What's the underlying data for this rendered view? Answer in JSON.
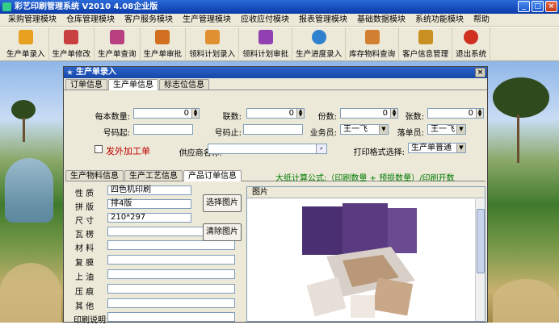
{
  "app": {
    "title": "彩艺印刷管理系统  V2010  4.08企业版"
  },
  "window_controls": {
    "minimize": "_",
    "maximize": "□",
    "close": "×"
  },
  "menu": [
    "采购管理模块",
    "仓库管理模块",
    "客户服务模块",
    "生产管理模块",
    "应收应付模块",
    "报表管理模块",
    "基础数据模块",
    "系统功能模块",
    "帮助"
  ],
  "toolbar": [
    {
      "label": "生产单录入",
      "icon": "doc-entry-icon",
      "color": "#e8a020"
    },
    {
      "label": "生产单修改",
      "icon": "doc-edit-icon",
      "color": "#c84040"
    },
    {
      "label": "生产单查询",
      "icon": "doc-search-icon",
      "color": "#b84080"
    },
    {
      "label": "生产单审批",
      "icon": "doc-approve-icon",
      "color": "#d07020"
    },
    {
      "label": "领料计划录入",
      "icon": "material-plan-icon",
      "color": "#e09030"
    },
    {
      "label": "领料计划审批",
      "icon": "material-approve-icon",
      "color": "#9040b0"
    },
    {
      "label": "生产进度录入",
      "icon": "progress-icon",
      "color": "#3080d0"
    },
    {
      "label": "库存物料查询",
      "icon": "inventory-icon",
      "color": "#d08030"
    },
    {
      "label": "客户信息管理",
      "icon": "customer-icon",
      "color": "#c89020"
    },
    {
      "label": "退出系统",
      "icon": "exit-icon",
      "color": "#d03020"
    }
  ],
  "dialog": {
    "title": "生产单录入",
    "tabs": [
      "订单信息",
      "生产单信息",
      "标志位信息"
    ],
    "active_tab": "生产单信息",
    "fields": {
      "each_qty_label": "每本数量:",
      "each_qty_value": "0",
      "joint_label": "联数:",
      "joint_value": "0",
      "copies_label": "份数:",
      "copies_value": "0",
      "sheets_label": "张数:",
      "sheets_value": "0",
      "num_start_label": "号码起:",
      "num_start_value": "",
      "num_end_label": "号码止:",
      "num_end_value": "",
      "salesman_label": "业务员:",
      "salesman_value": "王一飞",
      "orderer_label": "落单员:",
      "orderer_value": "王一飞",
      "outsource_label": "发外加工单",
      "supplier_label": "供应商名称:",
      "supplier_value": "",
      "print_format_label": "打印格式选择:",
      "print_format_value": "生产单普通"
    },
    "subtabs": [
      "生产物料信息",
      "生产工艺信息",
      "产品订单信息"
    ],
    "active_subtab": "产品订单信息",
    "formula": "大纸计算公式:（印刷数量 + 预损数量）/印刷开数",
    "product_rows": [
      {
        "label": "性 质",
        "value": "四色机印刷"
      },
      {
        "label": "拼 版",
        "value": "排4版"
      },
      {
        "label": "尺 寸",
        "value": "210*297"
      },
      {
        "label": "瓦 楞",
        "value": ""
      },
      {
        "label": "材 料",
        "value": ""
      },
      {
        "label": "复 膜",
        "value": ""
      },
      {
        "label": "上 油",
        "value": ""
      },
      {
        "label": "压 痕",
        "value": ""
      },
      {
        "label": "其 他",
        "value": ""
      },
      {
        "label": "印刷说明",
        "value": ""
      }
    ],
    "select_image_button": "选择图片",
    "clear_image_button": "清除图片",
    "image_panel_title": "图片"
  }
}
